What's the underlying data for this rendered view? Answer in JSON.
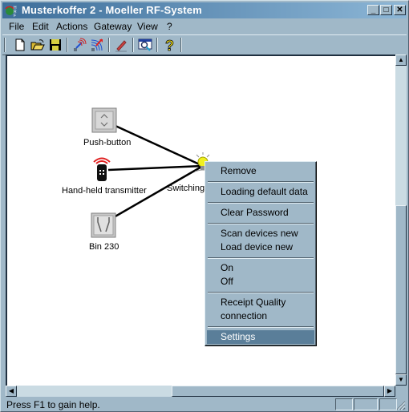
{
  "window": {
    "title": "Musterkoffer 2 - Moeller RF-System",
    "controls": {
      "minimize": "_",
      "maximize": "□",
      "close": "✕"
    }
  },
  "menubar": {
    "items": [
      {
        "label": "File"
      },
      {
        "label": "Edit"
      },
      {
        "label": "Actions"
      },
      {
        "label": "Gateway"
      },
      {
        "label": "View"
      },
      {
        "label": "?"
      }
    ]
  },
  "toolbar": {
    "buttons": [
      {
        "icon": "new-document-icon"
      },
      {
        "icon": "open-folder-icon"
      },
      {
        "icon": "save-disk-icon"
      },
      {
        "icon": "rf-receive-icon"
      },
      {
        "icon": "rf-send-icon"
      },
      {
        "icon": "edit-pen-icon"
      },
      {
        "icon": "search-monitor-icon"
      },
      {
        "icon": "help-icon"
      }
    ]
  },
  "diagram": {
    "nodes": [
      {
        "id": "push-button",
        "label": "Push-button"
      },
      {
        "id": "hand-held-transmitter",
        "label": "Hand-held transmitter"
      },
      {
        "id": "bin-230",
        "label": "Bin 230"
      },
      {
        "id": "switching",
        "label": "Switching"
      }
    ],
    "connections": [
      {
        "from": "push-button",
        "to": "switching"
      },
      {
        "from": "hand-held-transmitter",
        "to": "switching"
      },
      {
        "from": "bin-230",
        "to": "switching"
      }
    ]
  },
  "context_menu": {
    "items": [
      {
        "label": "Remove"
      },
      {
        "label": "Loading default data"
      },
      {
        "label": "Clear Password"
      },
      {
        "label": "Scan devices new"
      },
      {
        "label": "Load device new"
      },
      {
        "label": "On"
      },
      {
        "label": "Off"
      },
      {
        "label": "Receipt Quality"
      },
      {
        "label": "connection"
      },
      {
        "label": "Settings",
        "selected": true
      }
    ]
  },
  "statusbar": {
    "text": "Press F1 to gain help."
  },
  "colors": {
    "chrome": "#a0b8c8",
    "title_gradient_start": "#3d6e9a",
    "title_gradient_end": "#8cb6d6",
    "menu_highlight": "#5a7e99"
  }
}
